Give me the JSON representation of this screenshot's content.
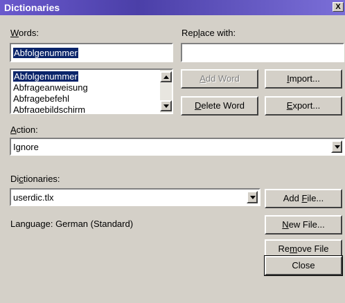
{
  "window": {
    "title": "Dictionaries",
    "close_glyph": "X"
  },
  "words": {
    "label_u": "W",
    "label_rest": "ords:",
    "value": "Abfolgenummer",
    "list": [
      "Abfolgenummer",
      "Abfrageanweisung",
      "Abfragebefehl",
      "Abfragebildschirm"
    ]
  },
  "replace": {
    "label_pre": "Rep",
    "label_u": "l",
    "label_post": "ace with:",
    "value": ""
  },
  "buttons": {
    "add_word_u": "A",
    "add_word_rest": "dd Word",
    "import_u": "I",
    "import_rest": "mport...",
    "delete_word_u": "D",
    "delete_word_rest": "elete Word",
    "export_u": "E",
    "export_rest": "xport...",
    "add_file_pre": "Add ",
    "add_file_u": "F",
    "add_file_post": "ile...",
    "new_file_u": "N",
    "new_file_rest": "ew File...",
    "remove_file_pre": "Re",
    "remove_file_u": "m",
    "remove_file_post": "ove File",
    "close": "Close"
  },
  "action": {
    "label_u": "A",
    "label_rest": "ction:",
    "value": "Ignore"
  },
  "dictionaries": {
    "label_pre": "Di",
    "label_u": "c",
    "label_post": "tionaries:",
    "value": "userdic.tlx"
  },
  "language": {
    "text": "Language: German (Standard)"
  },
  "colors": {
    "title_bar": "#4b3fa8",
    "selection": "#0a246a",
    "face": "#d4d0c8"
  }
}
